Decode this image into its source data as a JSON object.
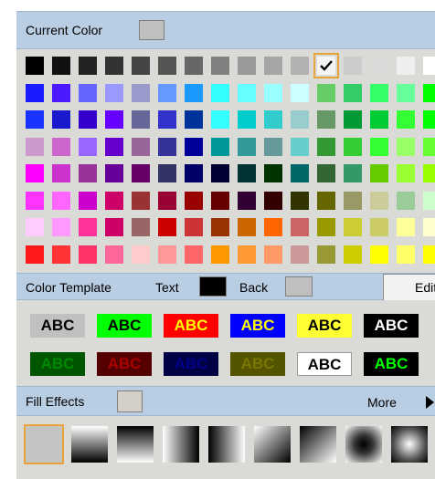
{
  "header": {
    "current_color_label": "Current Color",
    "current_color_value": "#bfbfbf"
  },
  "palette": {
    "selected": {
      "row": 0,
      "col": 11
    },
    "rows": [
      [
        "#000000",
        "#111111",
        "#222222",
        "#333333",
        "#444444",
        "#555555",
        "#666666",
        "#808080",
        "#999999",
        "#a6a6a6",
        "#b2b2b2",
        "#bfbfbf",
        "#cccccc",
        "#d9d9d9",
        "#eeeeee",
        "#ffffff"
      ],
      [
        "#1a1aff",
        "#4d1aff",
        "#6666ff",
        "#9999ff",
        "#9999cc",
        "#6699ff",
        "#1a99ff",
        "#33ffff",
        "#66ffff",
        "#99ffff",
        "#ccffff",
        "#66cc66",
        "#33cc66",
        "#33ff66",
        "#66ff99",
        "#00ff00"
      ],
      [
        "#1a33ff",
        "#1a1acc",
        "#3300cc",
        "#6600ff",
        "#666699",
        "#3333cc",
        "#003399",
        "#33ffff",
        "#00cccc",
        "#33cccc",
        "#99cccc",
        "#669966",
        "#009933",
        "#00cc33",
        "#33ff33",
        "#00ff00"
      ],
      [
        "#cc99cc",
        "#cc66cc",
        "#9966ff",
        "#6600cc",
        "#996699",
        "#333399",
        "#000099",
        "#009999",
        "#339999",
        "#669999",
        "#66cccc",
        "#339933",
        "#33cc33",
        "#33ff33",
        "#99ff66",
        "#66ff33"
      ],
      [
        "#ff00ff",
        "#cc33cc",
        "#993399",
        "#660099",
        "#660066",
        "#333366",
        "#000066",
        "#000033",
        "#003333",
        "#003300",
        "#006666",
        "#336633",
        "#339966",
        "#66cc00",
        "#99ff33",
        "#99ff00"
      ],
      [
        "#ff33ff",
        "#ff66ff",
        "#cc00cc",
        "#cc0066",
        "#993333",
        "#990033",
        "#990000",
        "#660000",
        "#330033",
        "#330000",
        "#333300",
        "#666600",
        "#999966",
        "#cccc99",
        "#99cc99",
        "#ccffcc"
      ],
      [
        "#ffccff",
        "#ff99ff",
        "#ff3399",
        "#cc0066",
        "#996666",
        "#cc0000",
        "#cc3333",
        "#993300",
        "#cc6600",
        "#ff6600",
        "#cc6666",
        "#999900",
        "#cccc33",
        "#cccc66",
        "#ffff99",
        "#ffffcc"
      ],
      [
        "#ff1a1a",
        "#ff3333",
        "#ff3366",
        "#ff6699",
        "#ffcccc",
        "#ff9999",
        "#ff6666",
        "#ff9900",
        "#ff9933",
        "#ff9966",
        "#cc9999",
        "#999933",
        "#cccc00",
        "#ffff00",
        "#ffff66",
        "#ffff00"
      ]
    ]
  },
  "template": {
    "label": "Color Template",
    "text_label": "Text",
    "text_color": "#000000",
    "back_label": "Back",
    "back_color": "#bfbfbf",
    "edit_label": "Edit",
    "swatches": [
      [
        {
          "text": "ABC",
          "fg": "#000000",
          "bg": "#c0c0c0"
        },
        {
          "text": "ABC",
          "fg": "#000000",
          "bg": "#00ff00"
        },
        {
          "text": "ABC",
          "fg": "#ffff00",
          "bg": "#ff0000"
        },
        {
          "text": "ABC",
          "fg": "#ffff00",
          "bg": "#0000ff"
        },
        {
          "text": "ABC",
          "fg": "#000000",
          "bg": "#ffff33"
        },
        {
          "text": "ABC",
          "fg": "#ffffff",
          "bg": "#000000"
        }
      ],
      [
        {
          "text": "ABC",
          "fg": "#008800",
          "bg": "#005500"
        },
        {
          "text": "ABC",
          "fg": "#aa0000",
          "bg": "#550000"
        },
        {
          "text": "ABC",
          "fg": "#000088",
          "bg": "#000044"
        },
        {
          "text": "ABC",
          "fg": "#777700",
          "bg": "#555500"
        },
        {
          "text": "ABC",
          "fg": "#000000",
          "bg": "#ffffff"
        },
        {
          "text": "ABC",
          "fg": "#00ff00",
          "bg": "#000000"
        }
      ]
    ]
  },
  "fill_effects": {
    "label": "Fill Effects",
    "current_color": "#d4d0c8",
    "more_label": "More",
    "selected_index": 0
  }
}
